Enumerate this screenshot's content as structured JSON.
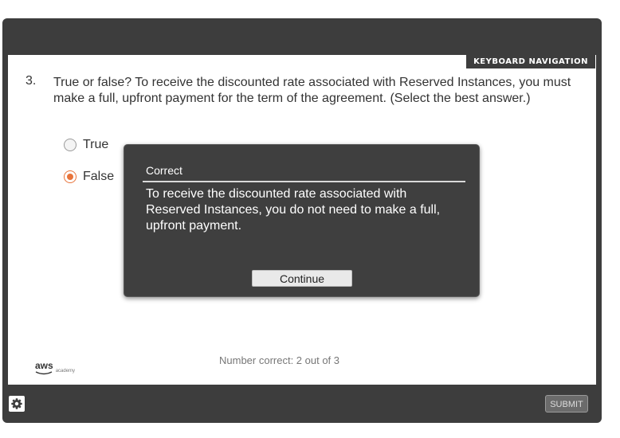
{
  "keyboard_nav_label": "KEYBOARD NAVIGATION",
  "question": {
    "number": "3.",
    "text": "True or false? To receive the discounted rate associated with Reserved Instances, you must make a full, upfront payment for the term of the agreement. (Select the best answer.)",
    "options": [
      {
        "label": "True",
        "selected": false
      },
      {
        "label": "False",
        "selected": true
      }
    ]
  },
  "feedback": {
    "title": "Correct",
    "body": "To receive the discounted rate associated with Reserved Instances, you do not need to make a full, upfront payment.",
    "button_label": "Continue"
  },
  "footer": {
    "logo_main": "aws",
    "logo_sub": "academy",
    "score_text": "Number correct: 2 out of 3",
    "submit_label": "SUBMIT"
  },
  "colors": {
    "frame": "#3d3d3d",
    "accent_selected": "#e8743b"
  },
  "icons": {
    "settings": "gear-icon"
  }
}
